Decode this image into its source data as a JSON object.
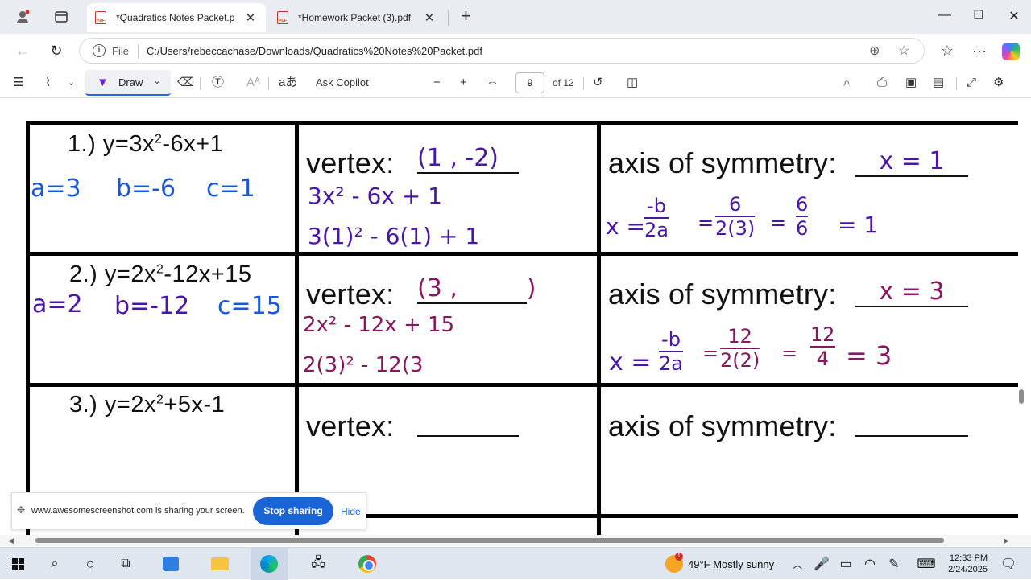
{
  "browser": {
    "tabs": [
      {
        "title": "*Quadratics Notes Packet.p",
        "active": true
      },
      {
        "title": "*Homework Packet (3).pdf",
        "active": false
      }
    ],
    "address": {
      "scheme_label": "File",
      "url": "C:/Users/rebeccachase/Downloads/Quadratics%20Notes%20Packet.pdf"
    }
  },
  "pdf_toolbar": {
    "draw_label": "Draw",
    "ask_copilot_label": "Ask Copilot",
    "page_current": "9",
    "page_total": "of 12"
  },
  "worksheet": {
    "rows": [
      {
        "equation_prefix": "1.) y=3x",
        "equation_suffix": "-6x+1",
        "abc": {
          "a": "a=3",
          "b": "b=-6",
          "c": "c=1"
        },
        "vertex_label": "vertex:",
        "vertex_answer": "(1 , -2)",
        "vertex_work": [
          "3x² - 6x + 1",
          "3(1)² - 6(1) + 1"
        ],
        "axis_label": "axis of symmetry:",
        "axis_answer": "x = 1",
        "axis_work": {
          "lhs": "x =",
          "f1": [
            "-b",
            "2a"
          ],
          "f2": [
            "6",
            "2(3)"
          ],
          "f3": [
            "6",
            "6"
          ],
          "result": "= 1"
        }
      },
      {
        "equation_prefix": "2.) y=2x",
        "equation_suffix": "-12x+15",
        "abc": {
          "a": "a=2",
          "b": "b=-12",
          "c": "c=15"
        },
        "vertex_label": "vertex:",
        "vertex_answer": "(3 ,         )",
        "vertex_work": [
          "2x² - 12x + 15",
          "2(3)² - 12(3"
        ],
        "axis_label": "axis of symmetry:",
        "axis_answer": "x = 3",
        "axis_work": {
          "lhs": "x =",
          "f1": [
            "-b",
            "2a"
          ],
          "f2": [
            "12",
            "2(2)"
          ],
          "f3": [
            "12",
            "4"
          ],
          "result": "= 3"
        }
      },
      {
        "equation_prefix": "3.) y=2x",
        "equation_suffix": "+5x-1",
        "vertex_label": "vertex:",
        "axis_label": "axis of symmetry:"
      }
    ]
  },
  "share_banner": {
    "message": "www.awesomescreenshot.com is sharing your screen.",
    "stop_label": "Stop sharing",
    "hide_label": "Hide"
  },
  "taskbar": {
    "weather_badge": "1",
    "weather": "49°F  Mostly sunny",
    "time": "12:33 PM",
    "date": "2/24/2025"
  },
  "colors": {
    "ink_blue": "#1858d8",
    "ink_purple": "#4a16a8",
    "ink_magenta": "#8a1660",
    "accent": "#1a64d6"
  }
}
